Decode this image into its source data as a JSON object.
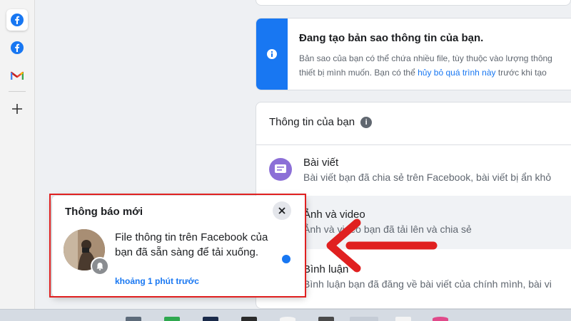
{
  "sidebar": {
    "items": [
      {
        "name": "facebook-app",
        "icon": "facebook-icon"
      },
      {
        "name": "facebook-app-2",
        "icon": "facebook-icon"
      },
      {
        "name": "gmail-app",
        "icon": "gmail-icon"
      },
      {
        "name": "add-app",
        "icon": "plus-icon"
      }
    ]
  },
  "banner": {
    "title": "Đang tạo bản sao thông tin của bạn.",
    "line1": "Bản sao của bạn có thể chứa nhiều file, tùy thuộc vào lượng thông",
    "line2_prefix": "thiết bị mình muốn. Bạn có thể ",
    "line2_link": "hủy bỏ quá trình này",
    "line2_suffix": " trước khi tạo",
    "icon": "info-icon"
  },
  "info": {
    "header": "Thông tin của bạn",
    "items": [
      {
        "title": "Bài viết",
        "desc": "Bài viết bạn đã chia sẻ trên Facebook, bài viết bị ẩn khỏ"
      },
      {
        "title": "Ảnh và video",
        "desc": "Ảnh và video bạn đã tải lên và chia sẻ"
      },
      {
        "title": "Bình luận",
        "desc": "Bình luận bạn đã đăng về bài viết của chính mình, bài vi"
      }
    ]
  },
  "notification": {
    "title": "Thông báo mới",
    "message": "File thông tin trên Facebook của bạn đã sẵn sàng để tải xuống.",
    "time": "khoảng 1 phút trước"
  },
  "colors": {
    "accent": "#1877f2",
    "highlight_frame": "#e02020",
    "post_icon_bg": "#8c6fd7"
  }
}
